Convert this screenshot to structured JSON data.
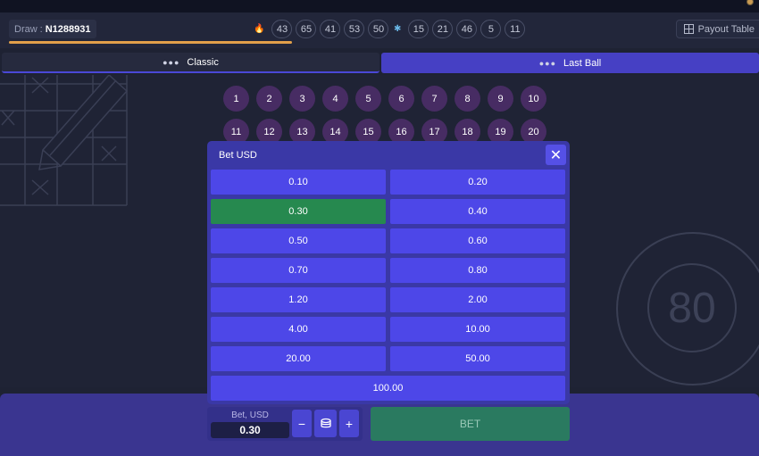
{
  "header": {
    "draw_label": "Draw",
    "draw_sep": ":",
    "draw_number": "N1288931",
    "hot_numbers": [
      "43",
      "65",
      "41",
      "53",
      "50"
    ],
    "cold_numbers": [
      "15",
      "21",
      "46",
      "5",
      "11"
    ],
    "payout_label": "Payout Table",
    "draw_progress": 0.77
  },
  "tabs": [
    {
      "label": "Classic",
      "active": true
    },
    {
      "label": "Last Ball",
      "active": false
    }
  ],
  "board": {
    "numbers": [
      "1",
      "2",
      "3",
      "4",
      "5",
      "6",
      "7",
      "8",
      "9",
      "10",
      "11",
      "12",
      "13",
      "14",
      "15",
      "16",
      "17",
      "18",
      "19",
      "20"
    ],
    "big_ball": "80"
  },
  "modal": {
    "title": "Bet USD",
    "options": [
      "0.10",
      "0.20",
      "0.30",
      "0.40",
      "0.50",
      "0.60",
      "0.70",
      "0.80",
      "1.20",
      "2.00",
      "4.00",
      "10.00",
      "20.00",
      "50.00",
      "100.00"
    ],
    "selected": "0.30"
  },
  "bet": {
    "caption": "Bet, USD",
    "value": "0.30",
    "minus": "−",
    "plus": "+",
    "button": "BET"
  },
  "colors": {
    "accent": "#4d47e8",
    "selected": "#26894f",
    "progress": "#e2a04a"
  }
}
